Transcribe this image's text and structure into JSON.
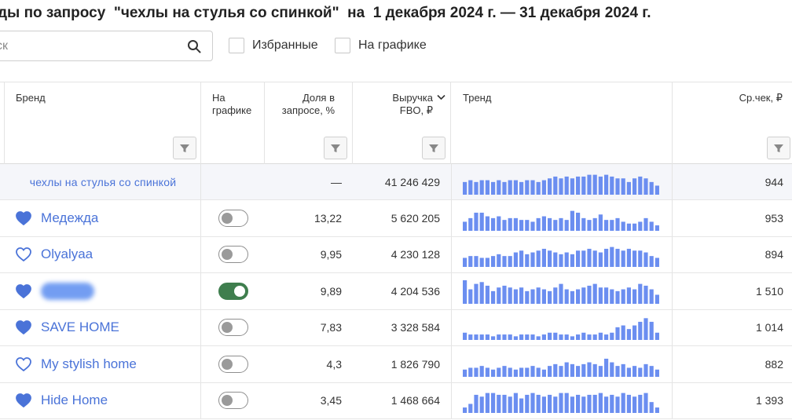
{
  "title": "ды по запросу  \"чехлы на стулья со спинкой\"  на  1 декабря 2024 г. — 31 декабря 2024 г.",
  "search": {
    "placeholder": "ск",
    "value": ""
  },
  "filters": {
    "favorites_label": "Избранные",
    "on_chart_label": "На графике"
  },
  "columns": {
    "brand": "Бренд",
    "on_chart": "На\nграфике",
    "share": "Доля в\nзапросе, %",
    "revenue": "Выручка\nFBO, ₽",
    "trend": "Тренд",
    "avg_check": "Ср.чек, ₽"
  },
  "colors": {
    "accent": "#4a73d8",
    "bar": "#6b8ef0",
    "toggle_on": "#3f7e4e"
  },
  "total": {
    "label": "чехлы на стулья со спинкой",
    "share": "—",
    "revenue": "41 246 429",
    "avg_check": "944",
    "trend": [
      7,
      8,
      7,
      8,
      8,
      7,
      8,
      7,
      8,
      8,
      7,
      8,
      8,
      7,
      8,
      9,
      10,
      9,
      10,
      9,
      10,
      10,
      11,
      11,
      10,
      11,
      10,
      9,
      9,
      7,
      9,
      10,
      9,
      7,
      5
    ]
  },
  "rows": [
    {
      "brand": "Медежда",
      "favorite": true,
      "on_chart": false,
      "share": "13,22",
      "revenue": "5 620 205",
      "avg_check": "953",
      "trend": [
        5,
        7,
        10,
        10,
        8,
        7,
        8,
        6,
        7,
        7,
        6,
        6,
        5,
        7,
        8,
        7,
        6,
        7,
        6,
        11,
        10,
        7,
        6,
        7,
        9,
        6,
        6,
        7,
        5,
        4,
        4,
        5,
        7,
        5,
        3
      ]
    },
    {
      "brand": "Olyalyaa",
      "favorite": false,
      "on_chart": false,
      "share": "9,95",
      "revenue": "4 230 128",
      "avg_check": "894",
      "trend": [
        5,
        6,
        6,
        5,
        5,
        6,
        7,
        6,
        6,
        8,
        9,
        7,
        8,
        9,
        10,
        9,
        8,
        7,
        8,
        7,
        9,
        9,
        10,
        9,
        8,
        10,
        11,
        10,
        9,
        10,
        9,
        9,
        8,
        6,
        5
      ]
    },
    {
      "brand": "",
      "blurred": true,
      "favorite": true,
      "on_chart": true,
      "share": "9,89",
      "revenue": "4 204 536",
      "avg_check": "1 510",
      "trend": [
        13,
        8,
        11,
        12,
        10,
        7,
        9,
        10,
        9,
        8,
        9,
        7,
        8,
        9,
        8,
        7,
        9,
        11,
        8,
        7,
        8,
        9,
        10,
        11,
        9,
        9,
        8,
        7,
        8,
        9,
        8,
        11,
        10,
        8,
        5
      ]
    },
    {
      "brand": "SAVE HOME",
      "favorite": true,
      "on_chart": false,
      "share": "7,83",
      "revenue": "3 328 584",
      "avg_check": "1 014",
      "trend": [
        4,
        3,
        3,
        3,
        3,
        2,
        3,
        3,
        3,
        2,
        3,
        3,
        3,
        2,
        3,
        4,
        4,
        3,
        3,
        2,
        3,
        4,
        3,
        3,
        4,
        3,
        4,
        7,
        8,
        6,
        8,
        10,
        12,
        10,
        4
      ]
    },
    {
      "brand": "My stylish home",
      "favorite": false,
      "on_chart": false,
      "share": "4,3",
      "revenue": "1 826 790",
      "avg_check": "882",
      "trend": [
        4,
        5,
        5,
        6,
        5,
        4,
        5,
        6,
        5,
        4,
        5,
        5,
        6,
        5,
        4,
        6,
        7,
        6,
        8,
        7,
        6,
        7,
        8,
        7,
        6,
        10,
        8,
        6,
        7,
        5,
        6,
        5,
        7,
        6,
        4
      ]
    },
    {
      "brand": "Hide Home",
      "favorite": true,
      "on_chart": false,
      "share": "3,45",
      "revenue": "1 468 664",
      "avg_check": "1 393",
      "trend": [
        3,
        5,
        10,
        9,
        11,
        11,
        10,
        10,
        9,
        11,
        8,
        10,
        11,
        10,
        9,
        10,
        9,
        11,
        11,
        9,
        10,
        9,
        10,
        10,
        11,
        9,
        10,
        9,
        11,
        10,
        9,
        10,
        11,
        6,
        3
      ]
    }
  ]
}
